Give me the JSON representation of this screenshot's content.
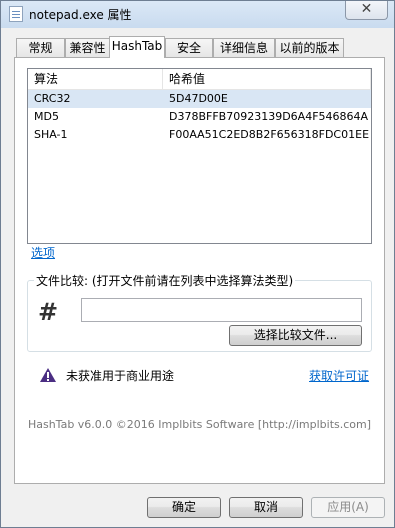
{
  "window": {
    "title": "notepad.exe 属性",
    "close_label": "✕"
  },
  "tabs": [
    "常规",
    "兼容性",
    "HashTab",
    "安全",
    "详细信息",
    "以前的版本"
  ],
  "list": {
    "columns": [
      "算法",
      "哈希值"
    ],
    "rows": [
      {
        "algo": "CRC32",
        "value": "5D47D00E",
        "selected": true
      },
      {
        "algo": "MD5",
        "value": "D378BFFB70923139D6A4F546864A..."
      },
      {
        "algo": "SHA-1",
        "value": "F00AA51C2ED8B2F656318FDC01EE..."
      }
    ]
  },
  "options_link": "选项",
  "compare": {
    "title": "文件比较: (打开文件前请在列表中选择算法类型)",
    "input_value": "",
    "button_label": "选择比较文件..."
  },
  "warning": {
    "text": "未获准用于商业用途",
    "link": "获取许可证"
  },
  "copyright": "HashTab v6.0.0 ©2016 Implbits Software [http://implbits.com]",
  "buttons": {
    "ok": "确定",
    "cancel": "取消",
    "apply": "应用(A)"
  },
  "colors": {
    "link": "#0066cc",
    "selection": "#d9e6f4",
    "warning_icon": "#4b2e83"
  },
  "icons": {
    "warning": "warning-triangle-icon",
    "hash": "hash-icon",
    "app": "notepad-app-icon"
  }
}
